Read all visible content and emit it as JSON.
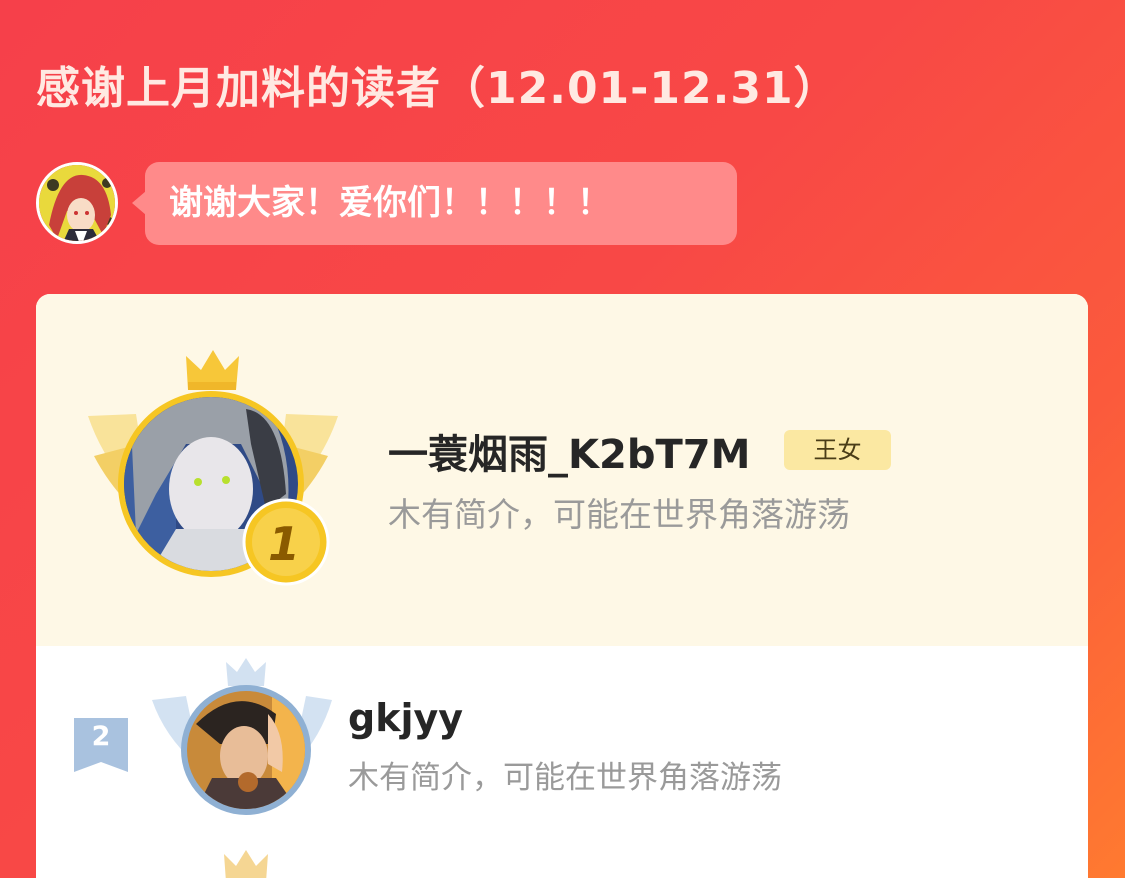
{
  "title": "感谢上月加料的读者（12.01-12.31）",
  "author": {
    "message": "谢谢大家！爱你们！！！！！"
  },
  "ranking": [
    {
      "rank": "1",
      "name": "一蓑烟雨_K2bT7M",
      "badge": "王女",
      "bio": "木有简介，可能在世界角落游荡"
    },
    {
      "rank": "2",
      "name": "gkjyy",
      "bio": "木有简介，可能在世界角落游荡"
    }
  ],
  "colors": {
    "background_start": "#f6404a",
    "background_end": "#ff7a30",
    "bubble": "#ff8a8a",
    "first_row_bg": "#fef8e6",
    "gold": "#f6c623",
    "silver_blue": "#8fb0d3"
  }
}
